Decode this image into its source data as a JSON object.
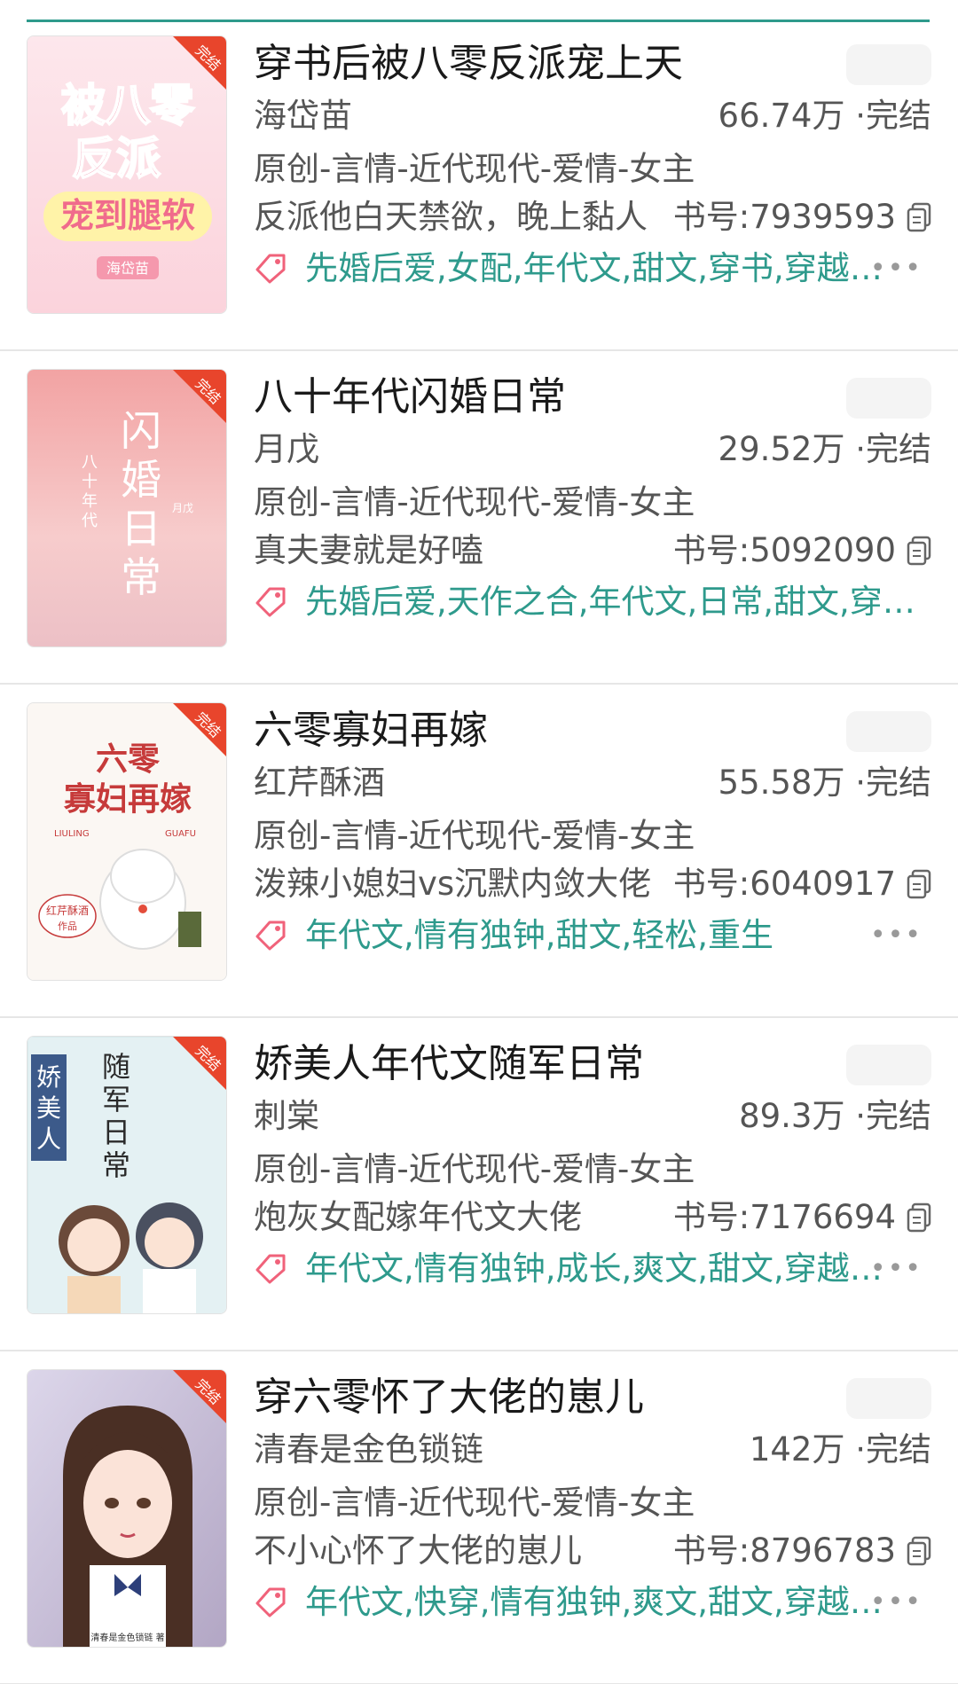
{
  "books": [
    {
      "title": "穿书后被八零反派宠上天",
      "author": "海岱苗",
      "meta": "66.74万 ·完结",
      "category": "原创-言情-近代现代-爱情-女主",
      "intro": "反派他白天禁欲，晚上黏人",
      "book_no": "书号:7939593",
      "tags": "先婚后爱,女配,年代文,甜文,穿书,穿越时空",
      "cover_text": "被八零反派宠到腿软",
      "cover_author": "海岱苗",
      "ribbon": "完结",
      "cover_colors": [
        "#fde7ec",
        "#f7b9c8"
      ]
    },
    {
      "title": "八十年代闪婚日常",
      "author": "月戊",
      "meta": "29.52万 ·完结",
      "category": "原创-言情-近代现代-爱情-女主",
      "intro": "真夫妻就是好嗑",
      "book_no": "书号:5092090",
      "tags": "先婚后爱,天作之合,年代文,日常,甜文,穿越时空",
      "cover_text": "闪婚日常",
      "cover_author": "月戊",
      "ribbon": "完结",
      "cover_colors": [
        "#f6c9c9",
        "#e89595"
      ]
    },
    {
      "title": "六零寡妇再嫁",
      "author": "红芹酥酒",
      "meta": "55.58万 ·完结",
      "category": "原创-言情-近代现代-爱情-女主",
      "intro": "泼辣小媳妇vs沉默内敛大佬",
      "book_no": "书号:6040917",
      "tags": "年代文,情有独钟,甜文,轻松,重生",
      "cover_text": "六零寡妇再嫁",
      "cover_author": "红芹酥酒",
      "ribbon": "完结",
      "cover_colors": [
        "#fbf7f3",
        "#f2ece6"
      ]
    },
    {
      "title": "娇美人年代文随军日常",
      "author": "刺棠",
      "meta": "89.3万 ·完结",
      "category": "原创-言情-近代现代-爱情-女主",
      "intro": "炮灰女配嫁年代文大佬",
      "book_no": "书号:7176694",
      "tags": "年代文,情有独钟,成长,爽文,甜文,穿越时空",
      "cover_text": "娇美人年代文随军日常",
      "cover_author": "刺棠",
      "ribbon": "完结",
      "cover_colors": [
        "#dfeef1",
        "#b9d9df"
      ]
    },
    {
      "title": "穿六零怀了大佬的崽儿",
      "author": "清春是金色锁链",
      "meta": "142万 ·完结",
      "category": "原创-言情-近代现代-爱情-女主",
      "intro": "不小心怀了大佬的崽儿",
      "book_no": "书号:8796783",
      "tags": "年代文,快穿,情有独钟,爽文,甜文,穿越时空",
      "cover_text": "清春是金色锁链",
      "cover_author": "清春是金色锁链",
      "ribbon": "完结",
      "cover_colors": [
        "#e7e3ef",
        "#a99ab8"
      ]
    }
  ],
  "more_label": "•••",
  "colors": {
    "accent": "#2e9a8c",
    "tag_icon": "#f0627a",
    "ribbon": "#e8452c"
  }
}
